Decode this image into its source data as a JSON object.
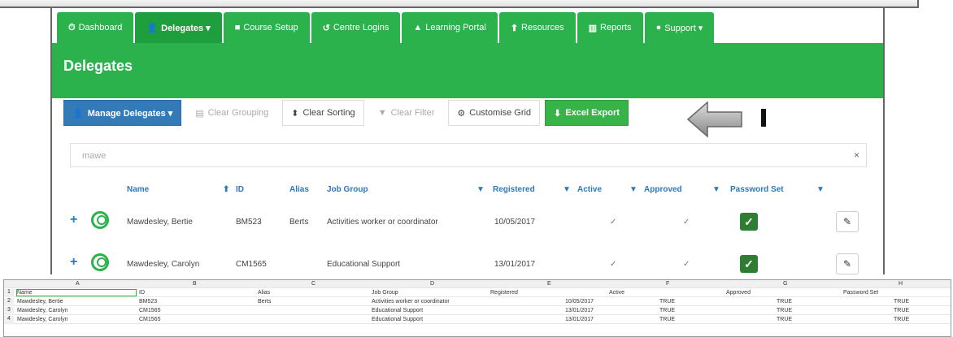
{
  "banner": {
    "text": "",
    "accent": ""
  },
  "tabs": [
    {
      "icon": "⏱",
      "label": "Dashboard"
    },
    {
      "icon": "👤",
      "label": "Delegates ▾"
    },
    {
      "icon": "■",
      "label": "Course Setup"
    },
    {
      "icon": "↺",
      "label": "Centre Logins"
    },
    {
      "icon": "▲",
      "label": "Learning Portal"
    },
    {
      "icon": "⬆",
      "label": "Resources"
    },
    {
      "icon": "▥",
      "label": "Reports"
    },
    {
      "icon": "●",
      "label": "Support ▾"
    }
  ],
  "page": {
    "title": "Delegates"
  },
  "toolbar": {
    "manage": "Manage Delegates ▾",
    "clear_grouping": "Clear Grouping",
    "clear_sorting": "Clear Sorting",
    "clear_filter": "Clear Filter",
    "customise_grid": "Customise Grid",
    "excel_export": "Excel Export"
  },
  "search": {
    "value": "mawe",
    "clear": "×"
  },
  "columns": {
    "name": "Name",
    "id": "ID",
    "alias": "Alias",
    "job_group": "Job Group",
    "registered": "Registered",
    "active": "Active",
    "approved": "Approved",
    "password_set": "Password Set"
  },
  "rows": [
    {
      "name": "Mawdesley, Bertie",
      "id": "BM523",
      "alias": "Berts",
      "job_group": "Activities worker or coordinator",
      "registered": "10/05/2017",
      "active": "✓",
      "approved": "✓"
    },
    {
      "name": "Mawdesley, Carolyn",
      "id": "CM1565",
      "alias": "",
      "job_group": "Educational Support",
      "registered": "13/01/2017",
      "active": "✓",
      "approved": "✓"
    }
  ],
  "sheet": {
    "letters": [
      "A",
      "B",
      "C",
      "D",
      "E",
      "F",
      "G",
      "H"
    ],
    "header": [
      "Name",
      "ID",
      "Alias",
      "Job Group",
      "Registered",
      "Active",
      "Approved",
      "Password Set"
    ],
    "rows": [
      [
        "Mawdesley, Bertie",
        "BM523",
        "Berts",
        "Activities worker or coordinator",
        "10/05/2017",
        "TRUE",
        "TRUE",
        "TRUE"
      ],
      [
        "Mawdesley, Carolyn",
        "CM1565",
        "",
        "Educational Support",
        "13/01/2017",
        "TRUE",
        "TRUE",
        "TRUE"
      ],
      [
        "Mawdesley, Carolyn",
        "CM1565",
        "",
        "Educational Support",
        "13/01/2017",
        "TRUE",
        "TRUE",
        "TRUE"
      ]
    ]
  }
}
